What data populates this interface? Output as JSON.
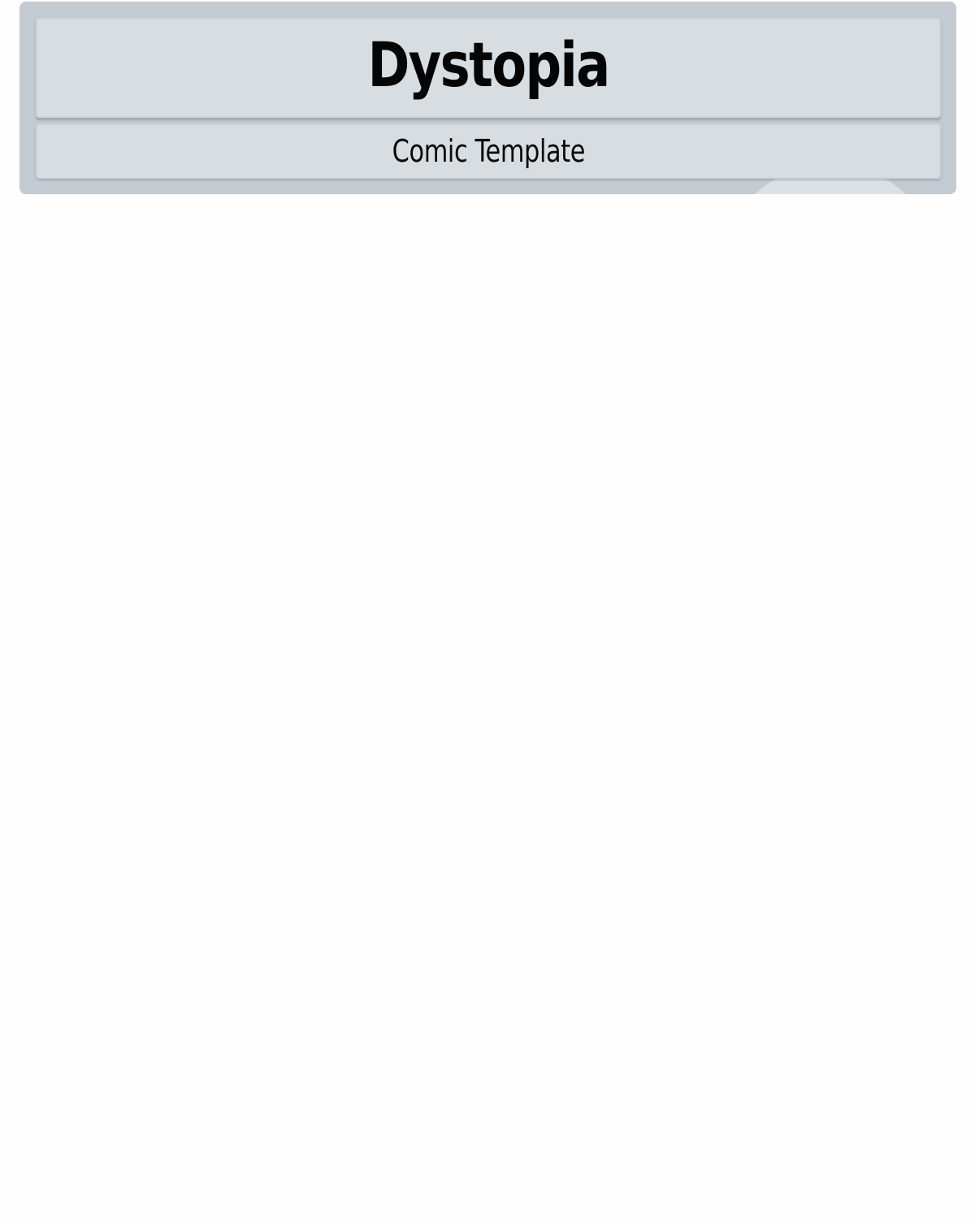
{
  "header": {
    "title": "Dystopia",
    "subtitle": "Comic Template"
  },
  "colors": {
    "frame": "#c3cad1",
    "panel": "#d8dde1",
    "text": "#050505",
    "page_background": "#fefefe"
  }
}
